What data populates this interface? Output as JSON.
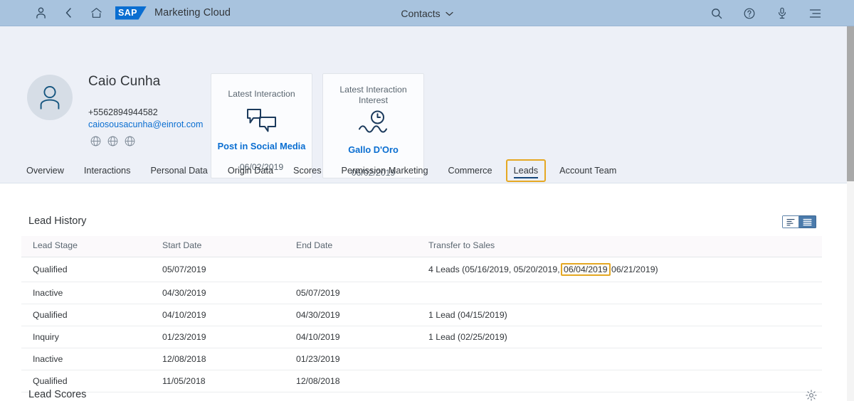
{
  "shellbar": {
    "user_icon": "person-icon",
    "back_icon": "chevron-left-icon",
    "home_icon": "home-icon",
    "logo_text": "SAP",
    "product_title": "Marketing Cloud",
    "app_title": "Contacts",
    "dropdown_icon": "chevron-down-icon",
    "search_icon": "search-icon",
    "help_icon": "question-mark-icon",
    "mic_icon": "microphone-icon",
    "menu_icon": "list-menu-icon",
    "bg_color": "#a8c3de"
  },
  "header": {
    "avatar_icon": "person-avatar-icon",
    "contact_name": "Caio Cunha",
    "phone": "+5562894944582",
    "email": "caiosousacunha@einrot.com",
    "email_color": "#0a6ed1",
    "social_icons": [
      "globe-icon",
      "globe-icon",
      "globe-icon"
    ],
    "cards": [
      {
        "label": "Latest Interaction",
        "icon": "speech-bubbles-icon",
        "value": "Post in Social Media",
        "date": "06/02/2019"
      },
      {
        "label": "Latest Interaction Interest",
        "icon": "clock-trend-icon",
        "value": "Gallo D'Oro",
        "date": "06/02/2019"
      }
    ]
  },
  "tabs": [
    {
      "label": "Overview",
      "selected": false
    },
    {
      "label": "Interactions",
      "selected": false
    },
    {
      "label": "Personal Data",
      "selected": false
    },
    {
      "label": "Origin Data",
      "selected": false
    },
    {
      "label": "Scores",
      "selected": false
    },
    {
      "label": "Permission Marketing",
      "selected": false
    },
    {
      "label": "Commerce",
      "selected": false
    },
    {
      "label": "Leads",
      "selected": true
    },
    {
      "label": "Account Team",
      "selected": false
    }
  ],
  "lead_history": {
    "title": "Lead History",
    "view_toggle": {
      "chart_view_icon": "chart-view-icon",
      "list_view_icon": "list-view-icon",
      "selected": "list"
    },
    "columns": [
      "Lead Stage",
      "Start Date",
      "End Date",
      "Transfer to Sales"
    ],
    "rows": [
      {
        "stage": "Qualified",
        "start": "05/07/2019",
        "end": "",
        "transfer_prefix": "4 Leads (05/16/2019, 05/20/2019, ",
        "transfer_highlight": "06/04/2019",
        "transfer_suffix": " 06/21/2019)"
      },
      {
        "stage": "Inactive",
        "start": "04/30/2019",
        "end": "05/07/2019",
        "transfer_prefix": "",
        "transfer_highlight": "",
        "transfer_suffix": ""
      },
      {
        "stage": "Qualified",
        "start": "04/10/2019",
        "end": "04/30/2019",
        "transfer_prefix": "1 Lead (04/15/2019)",
        "transfer_highlight": "",
        "transfer_suffix": ""
      },
      {
        "stage": "Inquiry",
        "start": "01/23/2019",
        "end": "04/10/2019",
        "transfer_prefix": "1 Lead (02/25/2019)",
        "transfer_highlight": "",
        "transfer_suffix": ""
      },
      {
        "stage": "Inactive",
        "start": "12/08/2018",
        "end": "01/23/2019",
        "transfer_prefix": "",
        "transfer_highlight": "",
        "transfer_suffix": ""
      },
      {
        "stage": "Qualified",
        "start": "11/05/2018",
        "end": "12/08/2018",
        "transfer_prefix": "",
        "transfer_highlight": "",
        "transfer_suffix": ""
      }
    ],
    "highlight_color": "#e5a823"
  },
  "lead_scores": {
    "title": "Lead Scores",
    "settings_icon": "gear-icon"
  }
}
